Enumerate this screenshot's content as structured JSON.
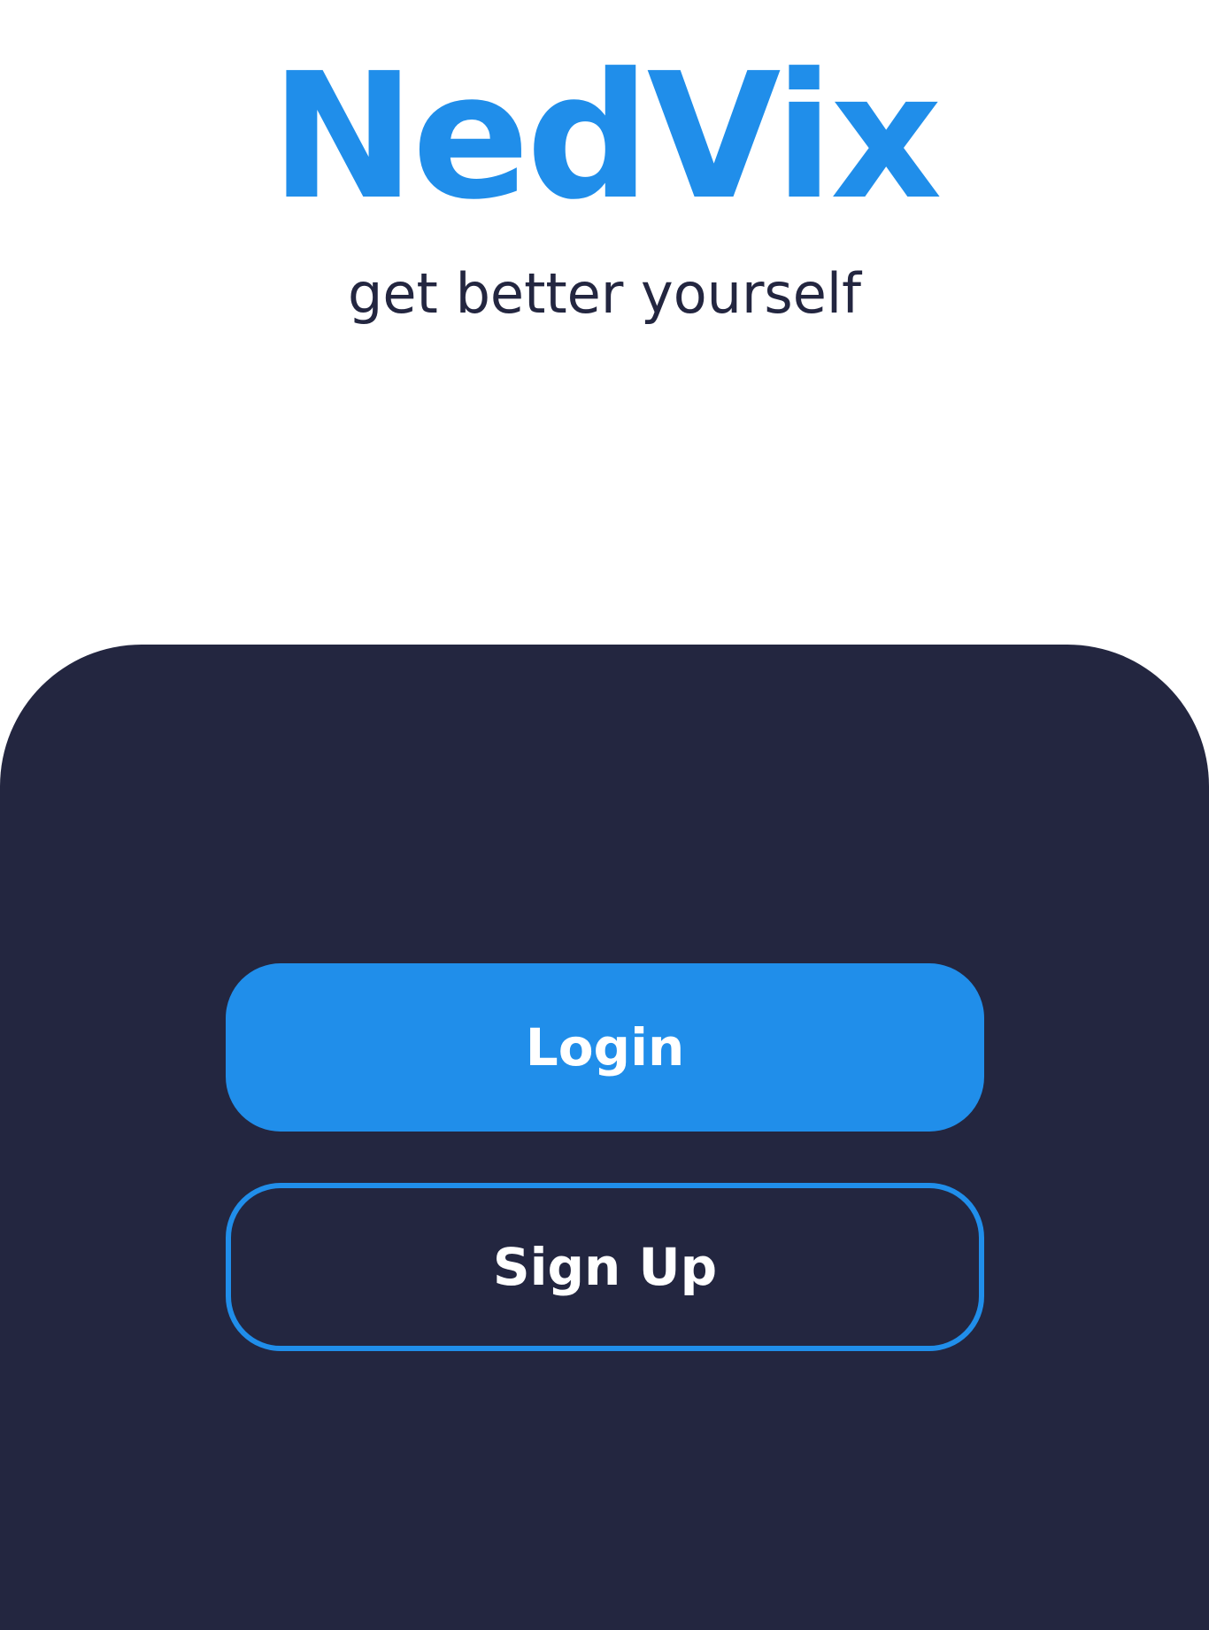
{
  "brand": {
    "name": "NedVix",
    "tagline": "get better yourself"
  },
  "actions": {
    "login_label": "Login",
    "signup_label": "Sign Up"
  },
  "colors": {
    "accent": "#208eea",
    "dark": "#232640",
    "background": "#ffffff",
    "button_text": "#ffffff"
  }
}
